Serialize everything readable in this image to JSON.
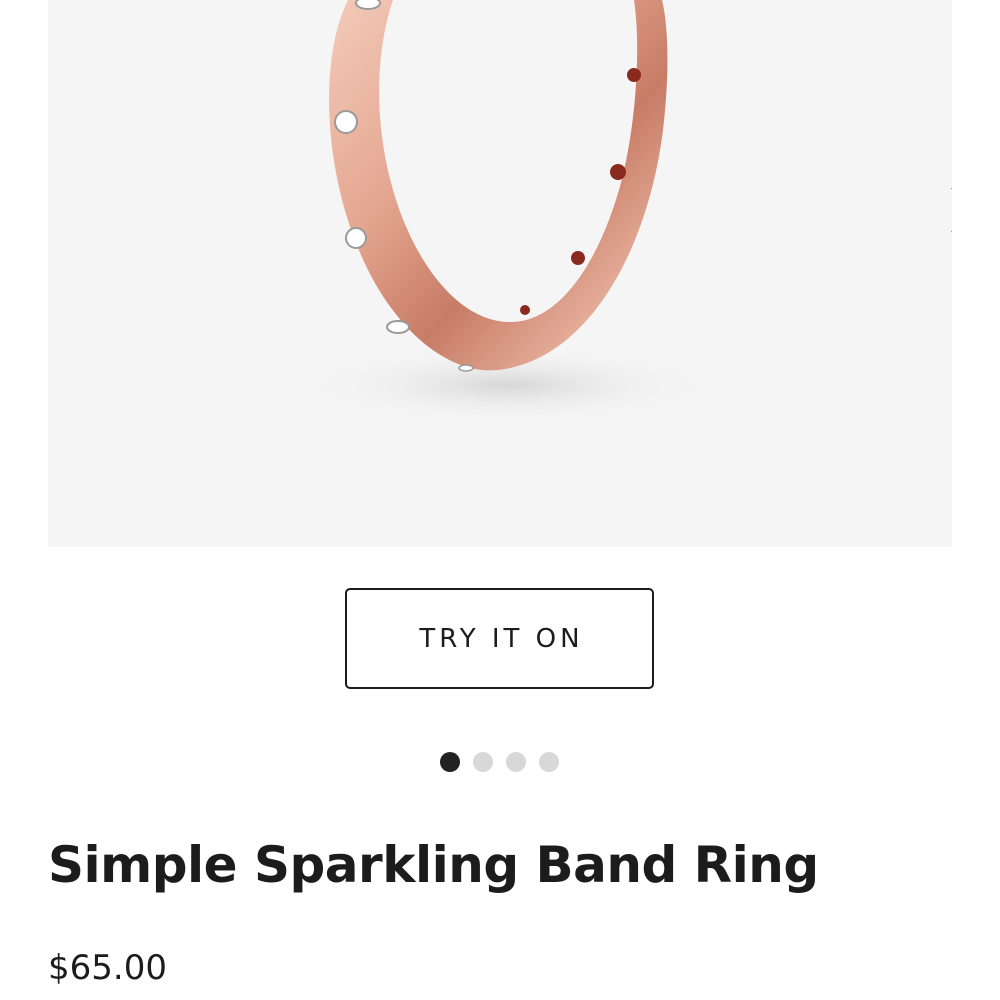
{
  "gallery": {
    "image_description_icon": "rose-gold-ring-icon",
    "next_icon": "chevron-right-icon",
    "background_color": "#f5f5f5",
    "ring_color": "#e2a48c"
  },
  "try_on": {
    "label": "TRY IT ON"
  },
  "carousel": {
    "total": 4,
    "active_index": 1
  },
  "product": {
    "title": "Simple Sparkling Band Ring",
    "price": "$65.00"
  }
}
